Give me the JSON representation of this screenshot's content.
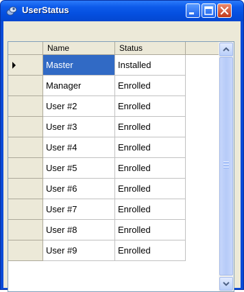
{
  "window": {
    "title": "UserStatus",
    "title_icon": "app-icon",
    "controls": [
      "minimize-icon",
      "maximize-icon",
      "close-icon"
    ]
  },
  "grid": {
    "columns": [
      "Name",
      "Status"
    ],
    "current_row_index": 0,
    "selected_cell": {
      "row": 0,
      "column": "Name"
    },
    "rows": [
      {
        "name": "Master",
        "status": "Installed"
      },
      {
        "name": "Manager",
        "status": "Enrolled"
      },
      {
        "name": "User #2",
        "status": "Enrolled"
      },
      {
        "name": "User #3",
        "status": "Enrolled"
      },
      {
        "name": "User #4",
        "status": "Enrolled"
      },
      {
        "name": "User #5",
        "status": "Enrolled"
      },
      {
        "name": "User #6",
        "status": "Enrolled"
      },
      {
        "name": "User #7",
        "status": "Enrolled"
      },
      {
        "name": "User #8",
        "status": "Enrolled"
      },
      {
        "name": "User #9",
        "status": "Enrolled"
      }
    ]
  },
  "scrollbar": {
    "icons": [
      "scroll-up-arrow-icon",
      "scroll-down-arrow-icon"
    ]
  },
  "colors": {
    "titlebar": "#0550E1",
    "selection": "#316AC5",
    "window_face": "#ECE9D8",
    "grid_border": "#7F9DB9"
  }
}
